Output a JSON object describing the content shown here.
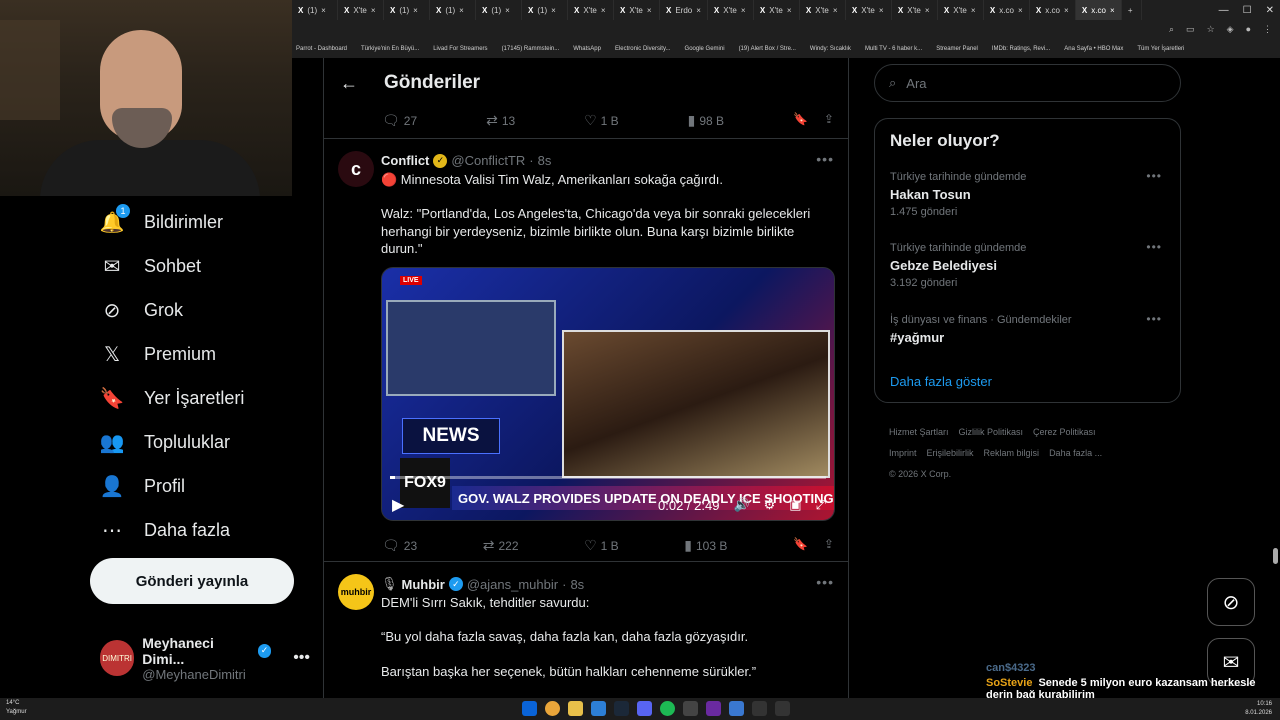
{
  "browser": {
    "tabs": [
      {
        "label": "(1) ",
        "active": false
      },
      {
        "label": "X'te",
        "active": false
      },
      {
        "label": "(1) ",
        "active": false
      },
      {
        "label": "(1) ",
        "active": false
      },
      {
        "label": "(1) ",
        "active": false
      },
      {
        "label": "(1) ",
        "active": false
      },
      {
        "label": "X'te",
        "active": false
      },
      {
        "label": "X'te",
        "active": false
      },
      {
        "label": "Erdo",
        "active": false
      },
      {
        "label": "X'te",
        "active": false
      },
      {
        "label": "X'te",
        "active": false
      },
      {
        "label": "X'te",
        "active": false
      },
      {
        "label": "X'te",
        "active": false
      },
      {
        "label": "X'te",
        "active": false
      },
      {
        "label": "X'te",
        "active": false
      },
      {
        "label": "x.co",
        "active": false
      },
      {
        "label": "x.co",
        "active": false
      },
      {
        "label": "x.co",
        "active": true
      }
    ],
    "bookmarks": [
      "Parrot - Dashboard",
      "Türkiye'nin En Büyü...",
      "Livad For Streamers",
      "(17145) Rammstein...",
      "WhatsApp",
      "Electronic Diversity...",
      "Google Gemini",
      "(19) Alert Box / Stre...",
      "Windy: Sıcaklık",
      "Multi TV - 6 haber k...",
      "Streamer Panel",
      "IMDb: Ratings, Revi...",
      "Ana Sayfa • HBO Max",
      "Tüm Yer İşaretleri"
    ]
  },
  "sidebar": {
    "items": [
      {
        "label": "Bildirimler",
        "icon": "bell-icon",
        "badge": "1"
      },
      {
        "label": "Sohbet",
        "icon": "envelope-icon"
      },
      {
        "label": "Grok",
        "icon": "grok-icon"
      },
      {
        "label": "Premium",
        "icon": "x-logo-icon"
      },
      {
        "label": "Yer İşaretleri",
        "icon": "bookmark-icon"
      },
      {
        "label": "Topluluklar",
        "icon": "people-icon"
      },
      {
        "label": "Profil",
        "icon": "person-icon"
      },
      {
        "label": "Daha fazla",
        "icon": "more-circle-icon"
      }
    ],
    "post_button": "Gönderi yayınla",
    "account": {
      "name": "Meyhaneci Dimi...",
      "handle": "@MeyhaneDimitri",
      "avatar_text": "DIMITRI"
    }
  },
  "main": {
    "title": "Gönderiler",
    "top_actions": {
      "replies": "27",
      "reposts": "13",
      "likes": "1 B",
      "views": "98 B"
    },
    "tweets": [
      {
        "avatar": "c",
        "name": "Conflict",
        "handle": "@ConflictTR",
        "time": "8s",
        "text1": "🔴 Minnesota Valisi Tim Walz, Amerikanları sokağa çağırdı.",
        "text2": "Walz: \"Portland'da, Los Angeles'ta, Chicago'da veya bir sonraki gelecekleri herhangi bir yerdeyseniz, bizimle birlikte olun. Buna karşı bizimle birlikte durun.\"",
        "video": {
          "live": "LIVE",
          "news": "NEWS",
          "channel": "FOX9",
          "ticker": "GOV. WALZ PROVIDES UPDATE ON DEADLY ICE SHOOTING",
          "time": "0:02 / 2:49",
          "progress": 0.012
        },
        "actions": {
          "replies": "23",
          "reposts": "222",
          "likes": "1 B",
          "views": "103 B"
        }
      },
      {
        "avatar": "muhbir",
        "name": "Muhbir",
        "handle": "@ajans_muhbir",
        "time": "8s",
        "text1": "DEM'li Sırrı Sakık, tehditler savurdu:",
        "text2": "“Bu yol daha fazla savaş, daha fazla kan, daha fazla gözyaşıdır.",
        "text3": "Barıştan başka her seçenek, bütün halkları cehenneme sürükler.”"
      }
    ]
  },
  "right": {
    "search_placeholder": "Ara",
    "trends_title": "Neler oluyor?",
    "trends": [
      {
        "context": "Türkiye tarihinde gündemde",
        "title": "Hakan Tosun",
        "count": "1.475 gönderi"
      },
      {
        "context": "Türkiye tarihinde gündemde",
        "title": "Gebze Belediyesi",
        "count": "3.192 gönderi"
      },
      {
        "context": "İş dünyası ve finans · Gündemdekiler",
        "title": "#yağmur",
        "count": ""
      }
    ],
    "show_more": "Daha fazla göster",
    "footer": [
      "Hizmet Şartları",
      "Gizlilik Politikası",
      "Çerez Politikası",
      "Imprint",
      "Erişilebilirlik",
      "Reklam bilgisi",
      "Daha fazla ...",
      "© 2026 X Corp."
    ]
  },
  "chat": [
    {
      "user": "can$4323",
      "message": "",
      "color": "#4a6a8a"
    },
    {
      "user": "SoStevie",
      "message": "Senede 5 milyon euro kazansam herkesle derin bağ kurabilirim",
      "color": "#e8a317"
    }
  ],
  "taskbar": {
    "weather_temp": "14°C",
    "weather_desc": "Yağmur",
    "time": "10:16",
    "date": "8.01.2026"
  }
}
